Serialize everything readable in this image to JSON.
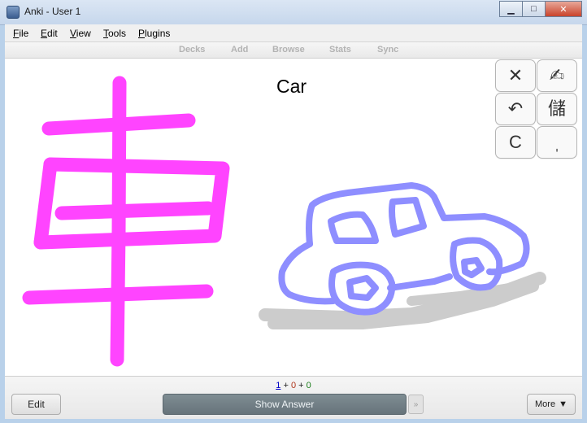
{
  "window": {
    "title": "Anki - User 1",
    "controls": {
      "minimize": "▁",
      "maximize": "□",
      "close": "✕"
    }
  },
  "menu": [
    {
      "acc": "F",
      "rest": "ile"
    },
    {
      "acc": "E",
      "rest": "dit"
    },
    {
      "acc": "V",
      "rest": "iew"
    },
    {
      "acc": "T",
      "rest": "ools"
    },
    {
      "acc": "P",
      "rest": "lugins"
    }
  ],
  "toolbar": {
    "decks": "Decks",
    "add": "Add",
    "browse": "Browse",
    "stats": "Stats",
    "sync": "Sync"
  },
  "card": {
    "front_word": "Car",
    "drawing_colors": {
      "kanji": "#ff44ff",
      "car": "#8e8eff",
      "shadow": "#cccccc"
    }
  },
  "drawing_tools": {
    "close": "✕",
    "pen": "✍",
    "undo": "↶",
    "kanji_button": "儲",
    "clear": "C",
    "comma": "ˌ"
  },
  "counts": {
    "new": "1",
    "learning": "0",
    "review": "0",
    "plus": "+"
  },
  "buttons": {
    "edit": "Edit",
    "show_answer": "Show Answer",
    "next": "»",
    "more": "More",
    "more_arrow": "▼"
  }
}
